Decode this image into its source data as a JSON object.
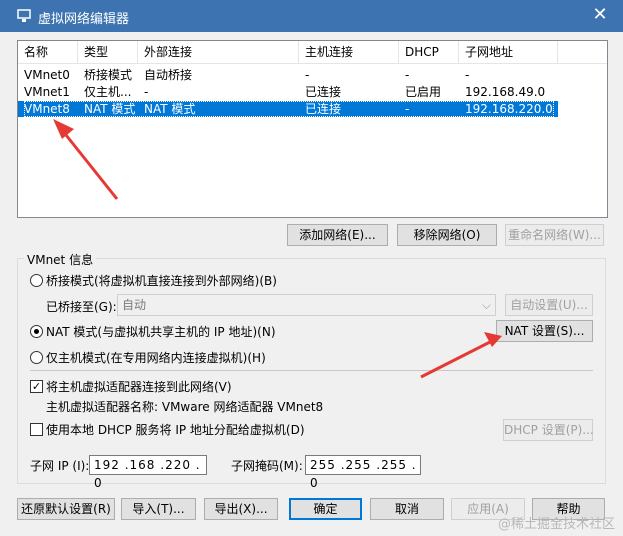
{
  "window": {
    "title": "虚拟网络编辑器",
    "close_glyph": "✕"
  },
  "network_table": {
    "columns": [
      "名称",
      "类型",
      "外部连接",
      "主机连接",
      "DHCP",
      "子网地址"
    ],
    "rows": [
      [
        "VMnet0",
        "桥接模式",
        "自动桥接",
        "-",
        "-",
        "-"
      ],
      [
        "VMnet1",
        "仅主机...",
        "-",
        "已连接",
        "已启用",
        "192.168.49.0"
      ],
      [
        "VMnet8",
        "NAT 模式",
        "NAT 模式",
        "已连接",
        "-",
        "192.168.220.0"
      ]
    ],
    "selected_row": 2
  },
  "list_buttons": {
    "add": "添加网络(E)...",
    "remove": "移除网络(O)",
    "rename": "重命名网络(W)..."
  },
  "vmnet_info": {
    "group_title": "VMnet 信息",
    "bridge_radio": "桥接模式(将虚拟机直接连接到外部网络)(B)",
    "bridged_to_label": "已桥接至(G):",
    "bridged_to_value": "自动",
    "auto_settings": "自动设置(U)...",
    "nat_radio": "NAT 模式(与虚拟机共享主机的 IP 地址)(N)",
    "nat_settings": "NAT 设置(S)...",
    "hostonly_radio": "仅主机模式(在专用网络内连接虚拟机)(H)",
    "connect_adapter_check": "将主机虚拟适配器连接到此网络(V)",
    "adapter_name_text": "主机虚拟适配器名称: VMware 网络适配器 VMnet8",
    "dhcp_check": "使用本地 DHCP 服务将 IP 地址分配给虚拟机(D)",
    "dhcp_settings": "DHCP 设置(P)...",
    "subnet_ip_label": "子网 IP (I):",
    "subnet_ip_value": "192 .168 .220 . 0",
    "subnet_mask_label": "子网掩码(M):",
    "subnet_mask_value": "255 .255 .255 . 0",
    "selected_mode": "nat",
    "connect_adapter_checked": true,
    "dhcp_checked": false
  },
  "footer_buttons": {
    "restore": "还原默认设置(R)",
    "import": "导入(T)...",
    "export": "导出(X)...",
    "ok": "确定",
    "cancel": "取消",
    "apply": "应用(A)",
    "help": "帮助"
  },
  "watermark": "@稀土掘金技术社区",
  "colors": {
    "selection": "#0078d7",
    "annotation_arrow": "#e53935",
    "titlebar": "#3c73b0"
  }
}
